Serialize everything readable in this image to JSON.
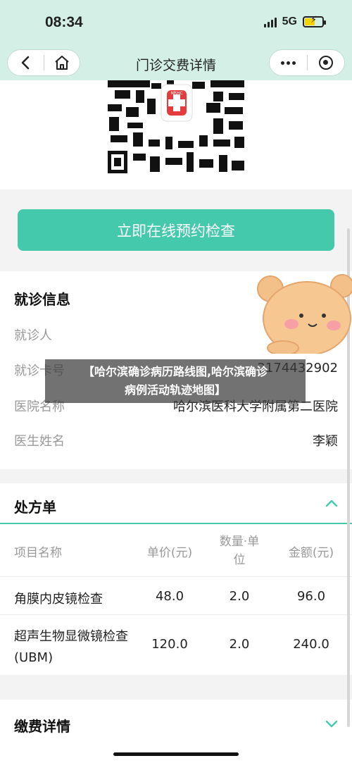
{
  "status_bar": {
    "time": "08:34",
    "network": "5G",
    "signal_bars": 4
  },
  "nav": {
    "title": "门诊交费详情"
  },
  "qr": {
    "badge_text": "NRHC"
  },
  "book_button": "立即在线预约检查",
  "visit_info": {
    "title": "就诊信息",
    "rows": [
      {
        "label": "就诊人",
        "value": ""
      },
      {
        "label": "就诊卡号",
        "value": "2174432902"
      },
      {
        "label": "医院名称",
        "value": "哈尔滨医科大学附属第二医院"
      },
      {
        "label": "医生姓名",
        "value": "李颖"
      }
    ]
  },
  "prescription": {
    "title": "处方单",
    "headers": [
      "项目名称",
      "单价(元)",
      "数量·单位",
      "金额(元)"
    ],
    "rows": [
      {
        "name": "角膜内皮镜检查",
        "price": "48.0",
        "qty": "2.0",
        "amount": "96.0"
      },
      {
        "name": "超声生物显微镜检查(UBM)",
        "price": "120.0",
        "qty": "2.0",
        "amount": "240.0"
      }
    ]
  },
  "payment": {
    "title": "缴费详情"
  },
  "overlay": {
    "line1": "【哈尔滨确诊病历路线图,哈尔滨确诊",
    "line2": "病例活动轨迹地图】"
  },
  "colors": {
    "accent": "#45c9ac",
    "nav_bg": "#d4f0e6",
    "battery": "#f5d300"
  }
}
